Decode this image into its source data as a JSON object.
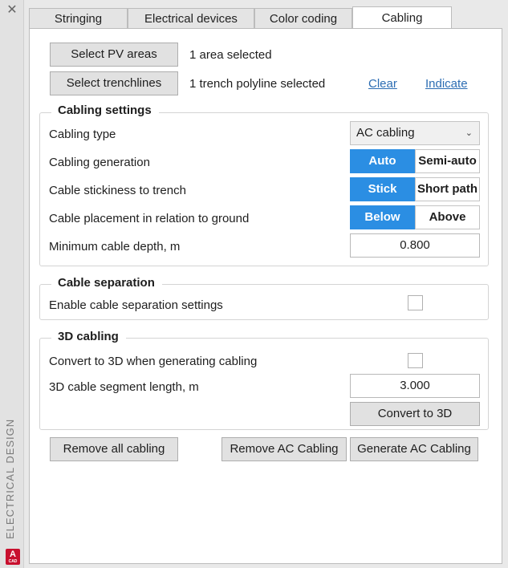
{
  "side_panel": {
    "label": "ELECTRICAL DESIGN",
    "logo_letter": "A",
    "logo_sub": "CAD"
  },
  "tabs": [
    {
      "label": "Stringing",
      "active": false
    },
    {
      "label": "Electrical devices",
      "active": false
    },
    {
      "label": "Color coding",
      "active": false
    },
    {
      "label": "Cabling",
      "active": true
    }
  ],
  "selection": {
    "pv_button": "Select PV areas",
    "pv_status": "1 area selected",
    "trench_button": "Select trenchlines",
    "trench_status": "1 trench polyline selected",
    "clear_link": "Clear",
    "indicate_link": "Indicate"
  },
  "cabling_settings": {
    "title": "Cabling settings",
    "type_label": "Cabling type",
    "type_value": "AC cabling",
    "generation_label": "Cabling generation",
    "generation_options": [
      "Auto",
      "Semi-auto"
    ],
    "generation_selected": "Auto",
    "stickiness_label": "Cable stickiness to trench",
    "stickiness_options": [
      "Stick",
      "Short path"
    ],
    "stickiness_selected": "Stick",
    "placement_label": "Cable placement in relation to ground",
    "placement_options": [
      "Below",
      "Above"
    ],
    "placement_selected": "Below",
    "depth_label": "Minimum cable depth, m",
    "depth_value": "0.800"
  },
  "cable_separation": {
    "title": "Cable separation",
    "enable_label": "Enable cable separation settings",
    "enabled": false
  },
  "cabling_3d": {
    "title": "3D cabling",
    "convert_label": "Convert to 3D when generating cabling",
    "convert_checked": false,
    "segment_label": "3D cable segment length, m",
    "segment_value": "3.000",
    "convert_button": "Convert to 3D"
  },
  "actions": {
    "remove_all": "Remove all cabling",
    "remove_ac": "Remove AC Cabling",
    "generate_ac": "Generate AC Cabling"
  },
  "colors": {
    "accent": "#2b8ee3",
    "link": "#2c6db3"
  }
}
